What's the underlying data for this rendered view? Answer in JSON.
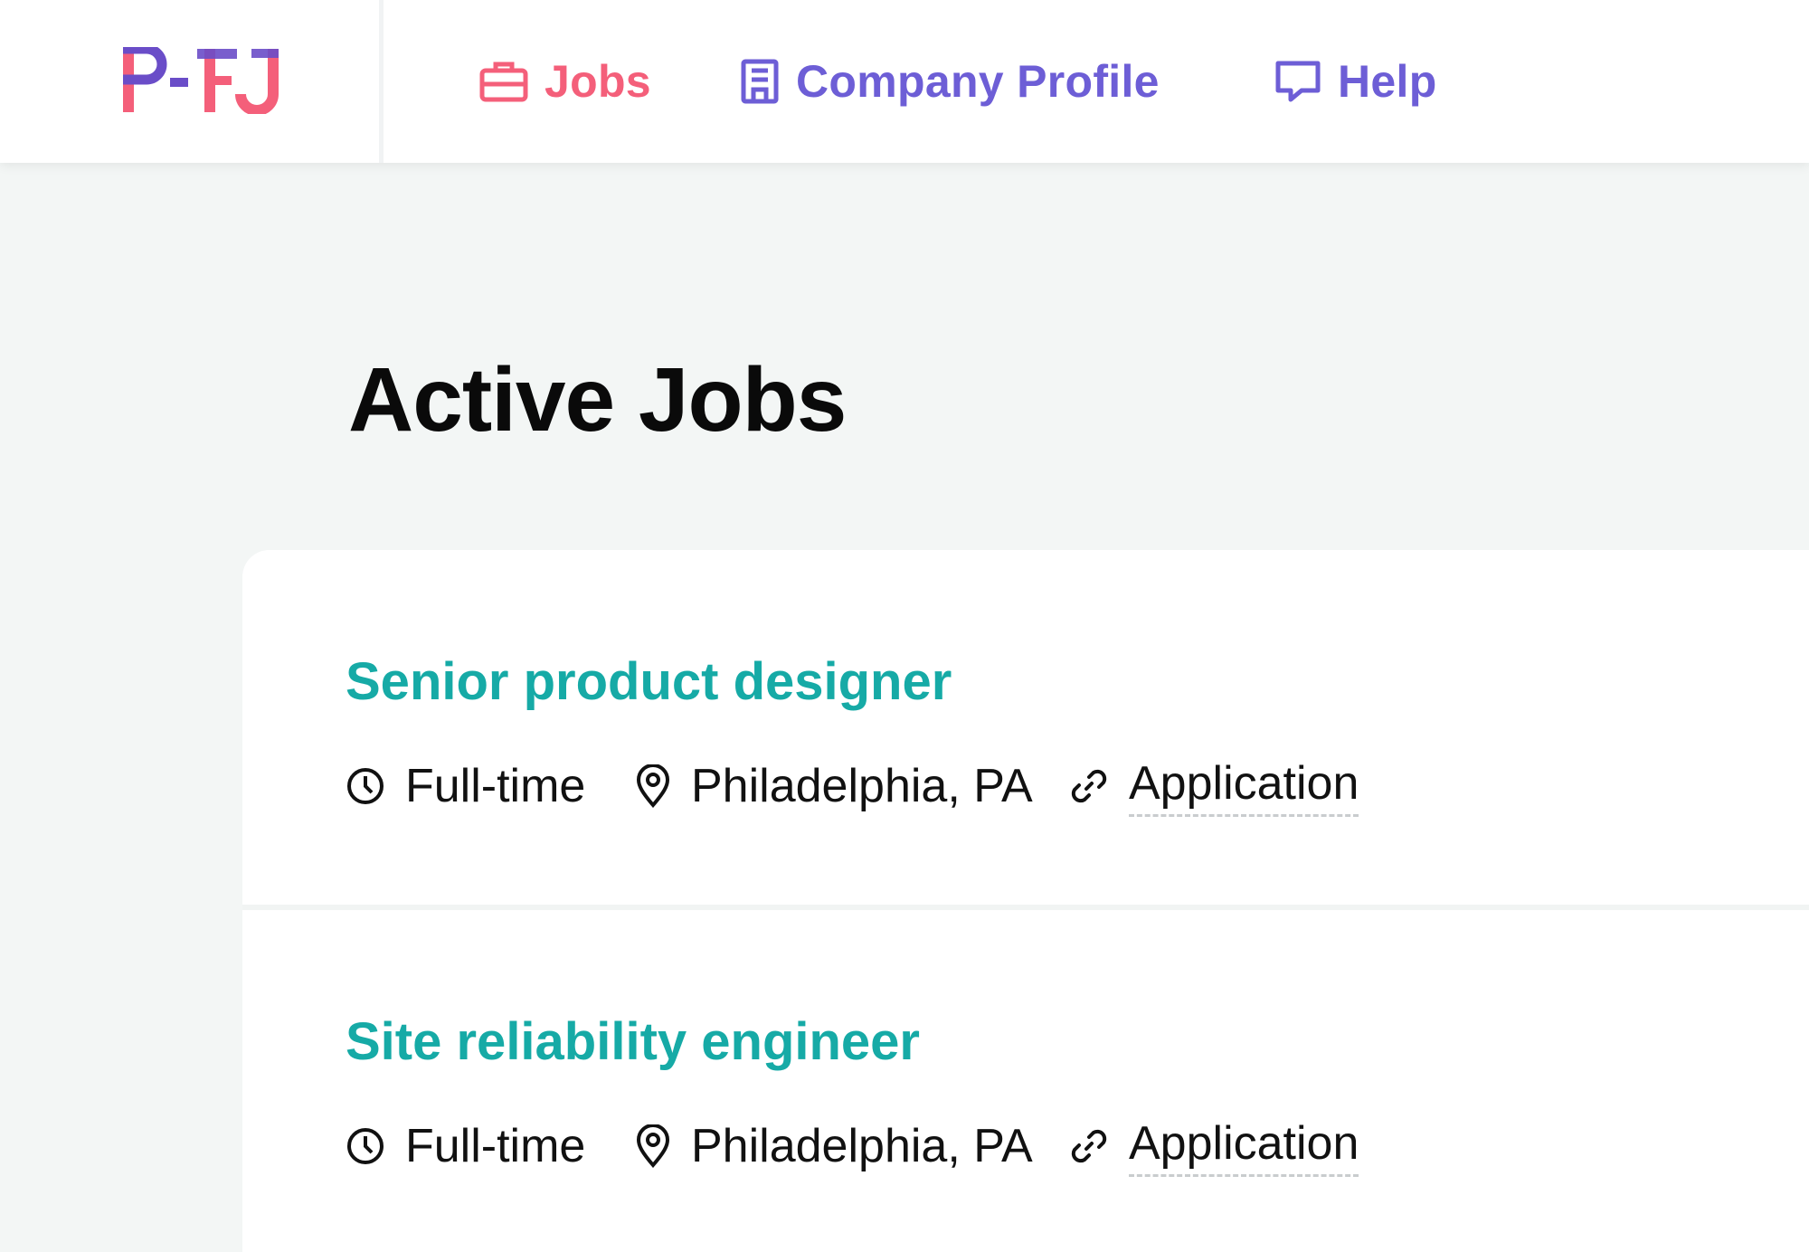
{
  "header": {
    "logo_text": "P-FJ",
    "nav": [
      {
        "label": "Jobs",
        "icon": "briefcase-icon",
        "color": "#f45f7a",
        "active": true
      },
      {
        "label": "Company Profile",
        "icon": "building-icon",
        "color": "#6d5ed6"
      },
      {
        "label": "Help",
        "icon": "chat-icon",
        "color": "#6d5ed6"
      }
    ]
  },
  "main": {
    "title": "Active Jobs",
    "jobs": [
      {
        "title": "Senior product designer",
        "type": "Full-time",
        "location": "Philadelphia, PA",
        "link_label": "Application"
      },
      {
        "title": "Site reliability engineer",
        "type": "Full-time",
        "location": "Philadelphia, PA",
        "link_label": "Application"
      }
    ]
  },
  "colors": {
    "accent_pink": "#f45f7a",
    "accent_purple": "#6d5ed6",
    "job_title_teal": "#16aaa6",
    "background": "#f3f6f5"
  },
  "icons": {
    "type": "clock-icon",
    "location": "map-pin-icon",
    "link": "link-icon"
  }
}
